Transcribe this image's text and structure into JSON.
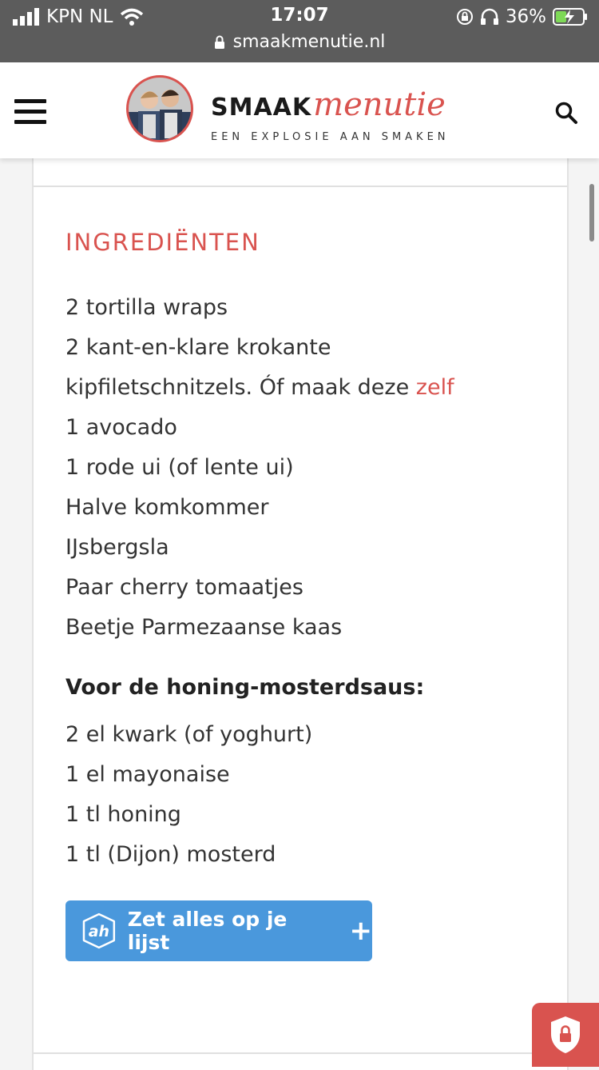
{
  "status_bar": {
    "carrier": "KPN NL",
    "time": "17:07",
    "battery": "36%",
    "url": "smaakmenutie.nl"
  },
  "header": {
    "logo_part1": "SMAAK",
    "logo_part2": "menutie",
    "tagline": "EEN EXPLOSIE AAN SMAKEN"
  },
  "recipe": {
    "section_title": "INGREDIËNTEN",
    "ingredients": [
      "2 tortilla wraps",
      "2 kant-en-klare krokante",
      "kipfiletschnitzels. Óf maak deze ",
      "1 avocado",
      "1 rode ui (of lente ui)",
      "Halve komkommer",
      "IJsbergsla",
      "Paar cherry tomaatjes",
      "Beetje Parmezaanse kaas"
    ],
    "ingredient_link": "zelf",
    "sauce_title": "Voor de honing-mosterdsaus:",
    "sauce_items": [
      "2 el kwark (of yoghurt)",
      "1 el mayonaise",
      "1 tl honing",
      "1 tl (Dijon) mosterd"
    ],
    "list_button": "Zet alles op je lijst",
    "list_button_icon": "+"
  },
  "colors": {
    "accent": "#d9534f",
    "button": "#4a98dc"
  }
}
